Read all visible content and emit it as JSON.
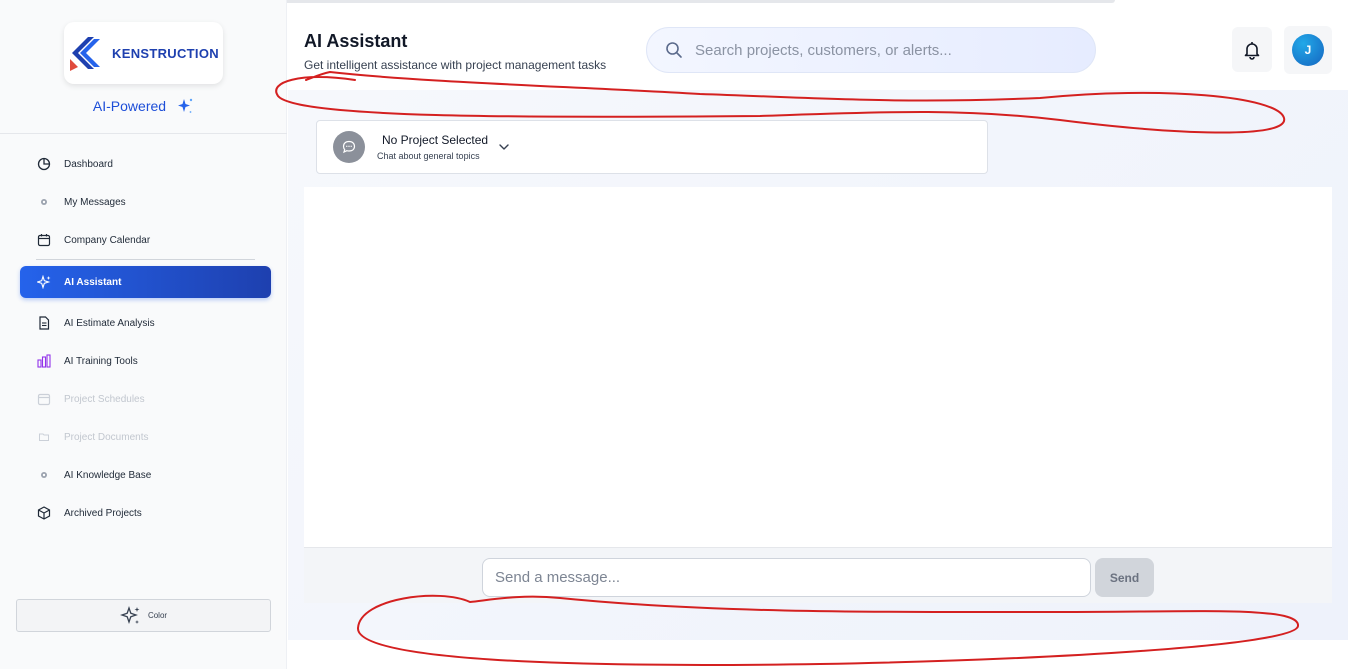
{
  "brand": {
    "logo_text": "KENSTRUCTION",
    "tagline": "AI-Powered",
    "accent": "#2563eb"
  },
  "sidebar": {
    "items": [
      {
        "label": "Dashboard",
        "icon": "pie-chart-icon",
        "state": "normal"
      },
      {
        "label": "My Messages",
        "icon": "dot-icon",
        "state": "normal"
      },
      {
        "label": "Company Calendar",
        "icon": "calendar-icon",
        "state": "normal"
      },
      {
        "label": "AI Assistant",
        "icon": "sparkle-icon",
        "state": "active"
      },
      {
        "label": "AI Estimate Analysis",
        "icon": "document-icon",
        "state": "normal"
      },
      {
        "label": "AI Training Tools",
        "icon": "bar-chart-icon",
        "state": "normal"
      },
      {
        "label": "Project Schedules",
        "icon": "calendar-icon",
        "state": "disabled"
      },
      {
        "label": "Project Documents",
        "icon": "folder-icon",
        "state": "disabled"
      },
      {
        "label": "AI Knowledge Base",
        "icon": "dot-icon",
        "state": "normal"
      },
      {
        "label": "Archived Projects",
        "icon": "box-icon",
        "state": "normal"
      }
    ],
    "color_button_label": "Color"
  },
  "header": {
    "title": "AI Assistant",
    "subtitle": "Get intelligent assistance with project management tasks",
    "search_placeholder": "Search projects, customers, or alerts...",
    "avatar_initial": "J"
  },
  "project_selector": {
    "title": "No Project Selected",
    "subtitle": "Chat about general topics"
  },
  "composer": {
    "placeholder": "Send a message...",
    "send_label": "Send"
  },
  "colors": {
    "active_nav": "#2563eb",
    "annotation": "#d42020"
  }
}
